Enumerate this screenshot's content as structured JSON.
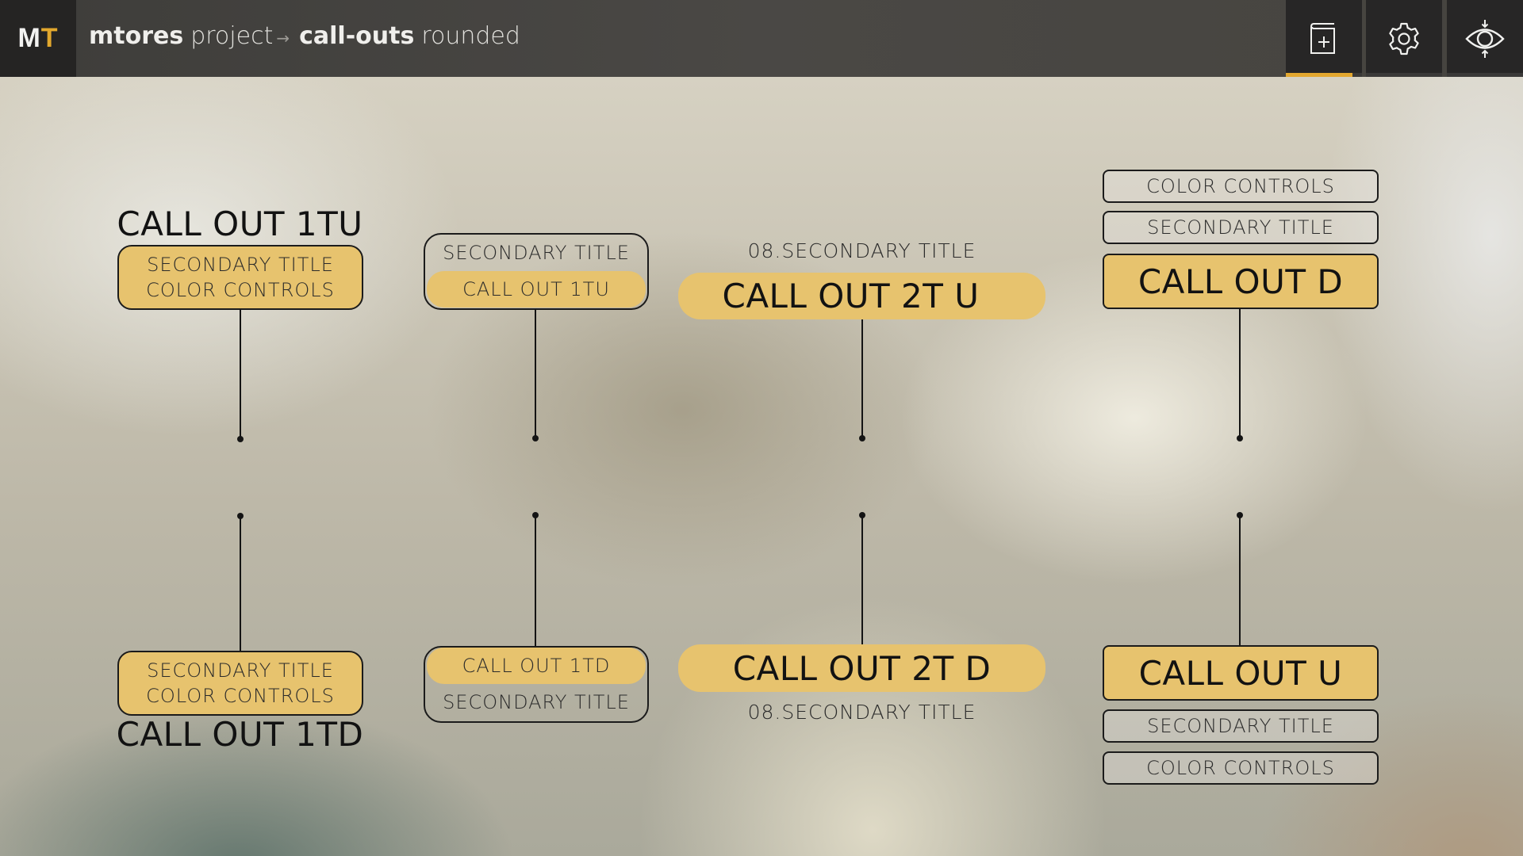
{
  "header": {
    "logo": {
      "m": "M",
      "t": "T"
    },
    "breadcrumb": {
      "project_bold": "mtores",
      "project_light": "project",
      "separator": "→",
      "page_bold": "call-outs",
      "page_light": "rounded"
    },
    "buttons": [
      {
        "name": "add-book",
        "icon": "book-plus-icon",
        "active": true
      },
      {
        "name": "settings",
        "icon": "gear-icon",
        "active": false
      },
      {
        "name": "preview",
        "icon": "eye-icon",
        "active": false
      }
    ]
  },
  "colors": {
    "accent": "#e3a72e",
    "callout_fill": "#e7c36e",
    "line": "#141414",
    "header_bg": "#46443f",
    "header_button_bg": "#272626"
  },
  "callouts": {
    "col1": {
      "top": {
        "title": "CALL OUT 1TU",
        "line1": "SECONDARY TITLE",
        "line2": "COLOR CONTROLS"
      },
      "bottom": {
        "title": "CALL OUT 1TD",
        "line1": "SECONDARY TITLE",
        "line2": "COLOR CONTROLS"
      }
    },
    "col2": {
      "top": {
        "secondary": "SECONDARY TITLE",
        "title": "CALL OUT 1TU"
      },
      "bottom": {
        "title": "CALL OUT 1TD",
        "secondary": "SECONDARY TITLE"
      }
    },
    "col3": {
      "top": {
        "secondary": "08.SECONDARY TITLE",
        "title": "CALL OUT 2T U"
      },
      "bottom": {
        "title": "CALL OUT 2T D",
        "secondary": "08.SECONDARY TITLE"
      }
    },
    "col4": {
      "top": {
        "color_controls": "COLOR CONTROLS",
        "secondary": "SECONDARY TITLE",
        "title": "CALL OUT D"
      },
      "bottom": {
        "title": "CALL OUT U",
        "secondary": "SECONDARY TITLE",
        "color_controls": "COLOR CONTROLS"
      }
    }
  }
}
